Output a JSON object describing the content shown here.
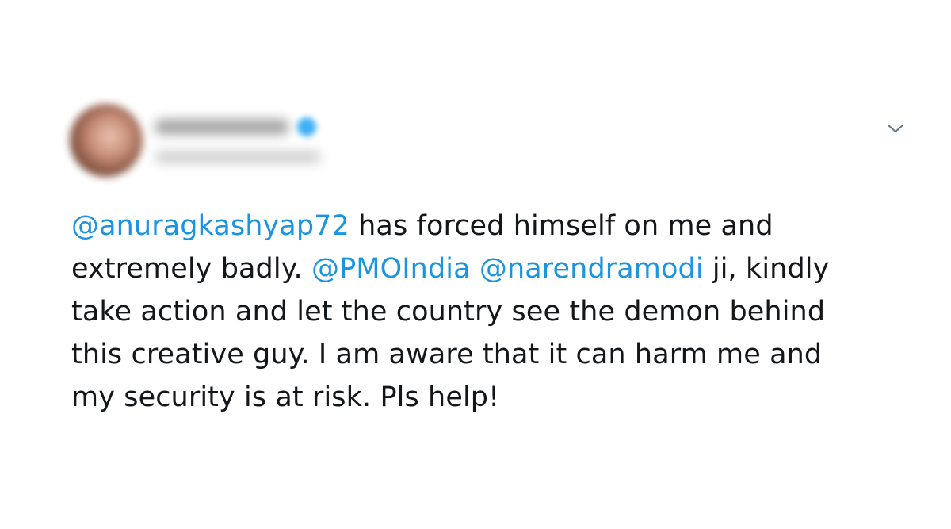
{
  "tweet": {
    "more_icon": "chevron-down-icon",
    "colors": {
      "text": "#14171a",
      "mention": "#1b95e0",
      "verified": "#1da1f2",
      "caret": "#657786"
    },
    "lines": [
      [
        {
          "type": "mention",
          "text": "@anuragkashyap72"
        },
        {
          "type": "text",
          "text": " has forced himself on me and"
        }
      ],
      [
        {
          "type": "text",
          "text": "extremely badly. "
        },
        {
          "type": "mention",
          "text": "@PMOIndia"
        },
        {
          "type": "text",
          "text": " "
        },
        {
          "type": "mention",
          "text": "@narendramodi"
        },
        {
          "type": "text",
          "text": " ji, kindly"
        }
      ],
      [
        {
          "type": "text",
          "text": "take action and let the country see the demon behind"
        }
      ],
      [
        {
          "type": "text",
          "text": "this creative guy. I am aware that it can harm me and"
        }
      ],
      [
        {
          "type": "text",
          "text": "my security is at risk. Pls help!"
        }
      ]
    ]
  }
}
